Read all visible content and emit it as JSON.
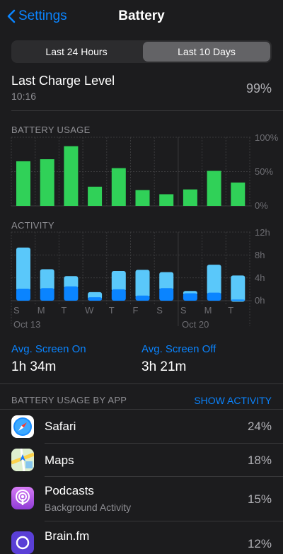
{
  "nav": {
    "back_label": "Settings",
    "title": "Battery"
  },
  "segments": [
    "Last 24 Hours",
    "Last 10 Days"
  ],
  "last_charge": {
    "label": "Last Charge Level",
    "time": "10:16",
    "value": "99%"
  },
  "battery_usage": {
    "header": "BATTERY USAGE",
    "ticks": [
      "100%",
      "50%",
      "0%"
    ]
  },
  "activity": {
    "header": "ACTIVITY",
    "ticks": [
      "12h",
      "8h",
      "4h",
      "0h"
    ],
    "days": [
      "S",
      "M",
      "T",
      "W",
      "T",
      "F",
      "S",
      "S",
      "M",
      "T"
    ],
    "weeks": [
      "Oct 13",
      "Oct 20"
    ]
  },
  "stats": {
    "screen_on_label": "Avg. Screen On",
    "screen_on_value": "1h 34m",
    "screen_off_label": "Avg. Screen Off",
    "screen_off_value": "3h 21m"
  },
  "apps_section": {
    "header": "BATTERY USAGE BY APP",
    "action": "SHOW ACTIVITY"
  },
  "apps": [
    {
      "name": "Safari",
      "sub": "",
      "pct": "24%",
      "icon": "safari-icon"
    },
    {
      "name": "Maps",
      "sub": "",
      "pct": "18%",
      "icon": "maps-icon"
    },
    {
      "name": "Podcasts",
      "sub": "Background Activity",
      "pct": "15%",
      "icon": "podcasts-icon"
    },
    {
      "name": "Brain.fm",
      "sub": "",
      "pct": "12%",
      "icon": "brainfm-icon"
    }
  ],
  "colors": {
    "accent": "#0a84ff",
    "battery_bar": "#30d158",
    "screen_on": "#0a84ff",
    "screen_off": "#5ac8fa",
    "background": "#1c1c1e"
  },
  "chart_data": [
    {
      "type": "bar",
      "title": "BATTERY USAGE",
      "categories": [
        "S",
        "M",
        "T",
        "W",
        "T",
        "F",
        "S",
        "S",
        "M",
        "T"
      ],
      "values": [
        65,
        68,
        87,
        28,
        55,
        23,
        17,
        24,
        51,
        34
      ],
      "ylim": [
        0,
        100
      ],
      "ytick_labels": [
        "100%",
        "50%",
        "0%"
      ],
      "grid": true
    },
    {
      "type": "bar",
      "title": "ACTIVITY",
      "categories": [
        "S",
        "M",
        "T",
        "W",
        "T",
        "F",
        "S",
        "S",
        "M",
        "T"
      ],
      "series": [
        {
          "values": [
            2.1,
            2.2,
            2.5,
            0.6,
            2.0,
            0.9,
            2.2,
            1.3,
            1.4,
            0.2
          ]
        },
        {
          "values": [
            7.2,
            3.3,
            1.8,
            0.9,
            3.2,
            4.5,
            2.8,
            0.4,
            4.9,
            4.2
          ]
        }
      ],
      "stacked": true,
      "ylim": [
        0,
        12
      ],
      "ytick_labels": [
        "12h",
        "8h",
        "4h",
        "0h"
      ],
      "x_group_labels": [
        "Oct 13",
        "Oct 20"
      ],
      "grid": true
    }
  ]
}
